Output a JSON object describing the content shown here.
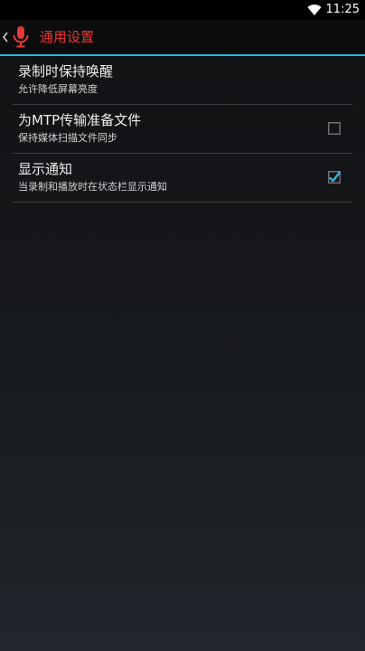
{
  "status_bar": {
    "time": "11:25",
    "wifi_icon": "wifi-icon"
  },
  "action_bar": {
    "back_icon": "chevron-left-icon",
    "app_icon": "microphone-icon",
    "title": "通用设置",
    "title_color": "#e53935",
    "accent_color": "#33b5e5"
  },
  "settings": [
    {
      "title": "录制时保持唤醒",
      "summary": "允许降低屏幕亮度"
    },
    {
      "title": "为MTP传输准备文件",
      "summary": "保持媒体扫描文件同步",
      "checked": false
    },
    {
      "title": "显示通知",
      "summary": "当录制和播放时在状态栏显示通知",
      "checked": true
    }
  ]
}
